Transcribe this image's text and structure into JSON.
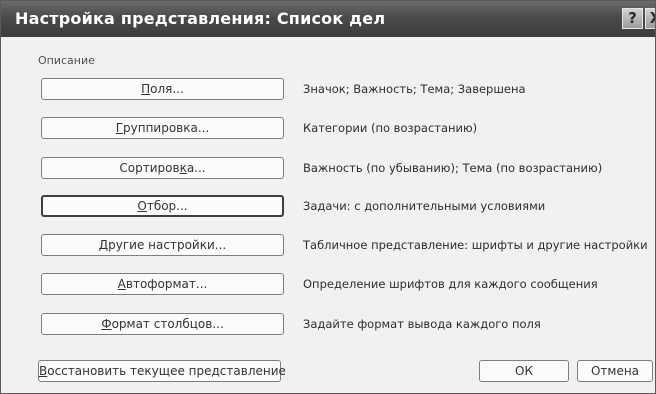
{
  "dialog": {
    "title": "Настройка представления: Список дел",
    "help_glyph": "?",
    "close_glyph": "X",
    "description_label": "Описание"
  },
  "rows": [
    {
      "button": {
        "pre": "",
        "accel": "П",
        "post": "оля..."
      },
      "info": "Значок; Важность; Тема; Завершена"
    },
    {
      "button": {
        "pre": "",
        "accel": "Г",
        "post": "руппировка..."
      },
      "info": "Категории (по возрастанию)"
    },
    {
      "button": {
        "pre": "Сортиров",
        "accel": "к",
        "post": "а..."
      },
      "info": "Важность (по убыванию); Тема (по возрастанию)"
    },
    {
      "button": {
        "pre": "",
        "accel": "О",
        "post": "тбор..."
      },
      "info": "Задачи: с дополнительными условиями"
    },
    {
      "button": {
        "pre": "",
        "accel": "Д",
        "post": "ругие настройки..."
      },
      "info": "Табличное представление: шрифты и другие настройки"
    },
    {
      "button": {
        "pre": "",
        "accel": "А",
        "post": "втоформат..."
      },
      "info": "Определение шрифтов для каждого сообщения"
    },
    {
      "button": {
        "pre": "",
        "accel": "Ф",
        "post": "ормат столбцов..."
      },
      "info": "Задайте формат вывода каждого поля"
    }
  ],
  "footer": {
    "reset": {
      "pre": "",
      "accel": "В",
      "post": "осстановить текущее представление"
    },
    "ok_label": "ОК",
    "cancel_label": "Отмена"
  }
}
